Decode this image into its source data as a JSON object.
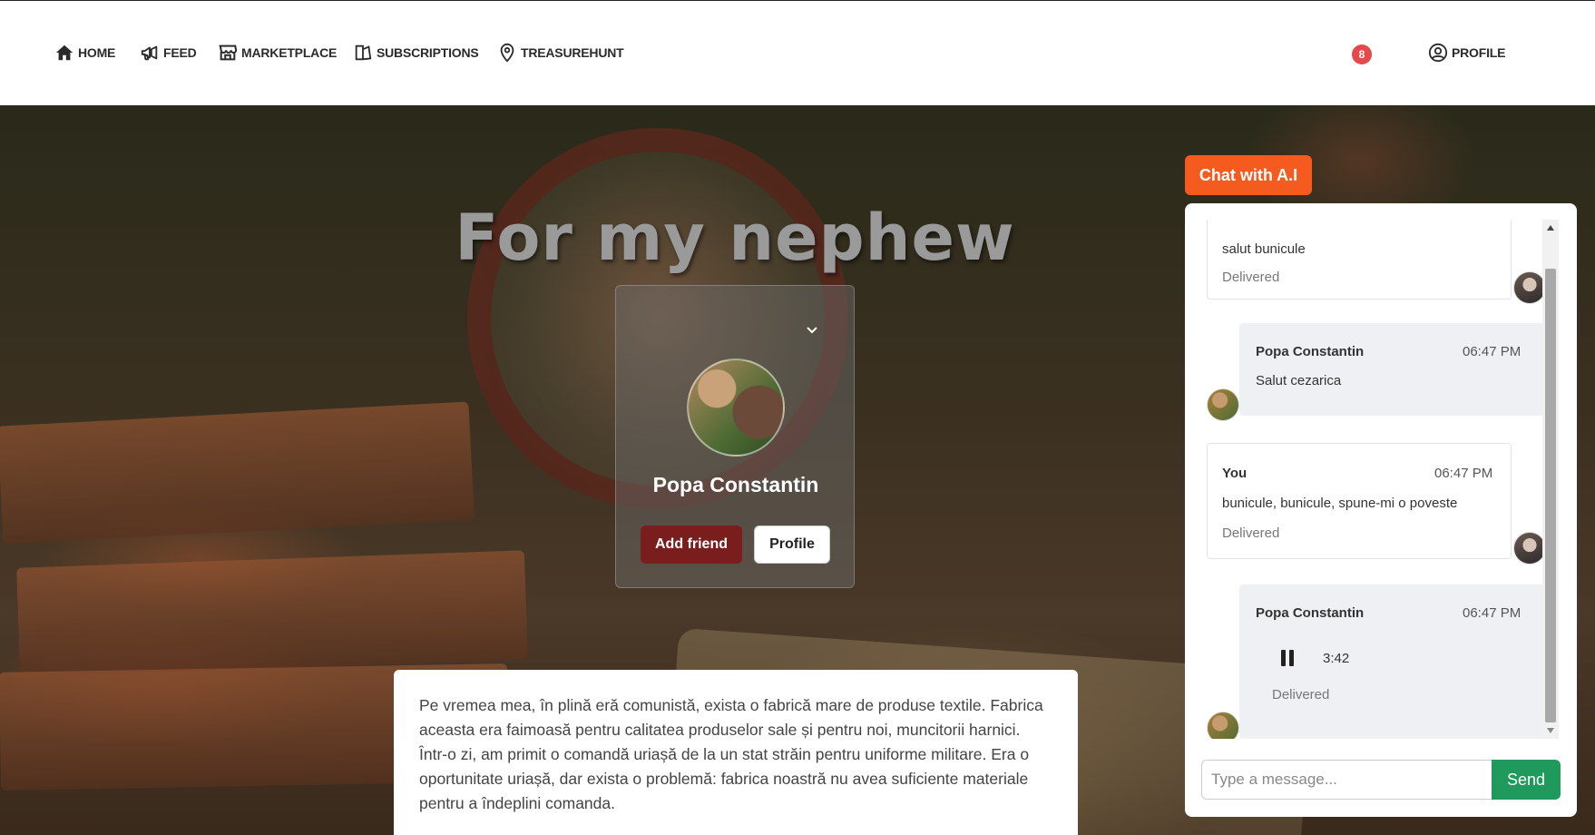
{
  "nav": {
    "home": "HOME",
    "feed": "FEED",
    "marketplace": "MARKETPLACE",
    "subscriptions": "SUBSCRIPTIONS",
    "treasurehunt": "TREASUREHUNT",
    "notifications_count": "8",
    "profile": "PROFILE"
  },
  "hero": {
    "title": "For my nephew"
  },
  "profile_card": {
    "name": "Popa Constantin",
    "add_friend_label": "Add friend",
    "profile_label": "Profile"
  },
  "story": {
    "text": "Pe vremea mea, în plină eră comunistă, exista o fabrică mare de produse textile. Fabrica aceasta era faimoasă pentru calitatea produselor sale și pentru noi, muncitorii harnici. Într-o zi, am primit o comandă uriașă de la un stat străin pentru uniforme militare. Era o oportunitate uriașă, dar exista o problemă: fabrica noastră nu avea suficiente materiale pentru a îndeplini comanda."
  },
  "chat": {
    "ai_button": "Chat with A.I",
    "messages": [
      {
        "text": "salut bunicule",
        "status": "Delivered"
      },
      {
        "name": "Popa Constantin",
        "time": "06:47 PM",
        "text": "Salut cezarica"
      },
      {
        "name": "You",
        "time": "06:47 PM",
        "text": "bunicule, bunicule, spune-mi o poveste",
        "status": "Delivered"
      },
      {
        "name": "Popa Constantin",
        "time": "06:47 PM",
        "audio_duration": "3:42",
        "status": "Delivered"
      }
    ],
    "input_placeholder": "Type a message...",
    "send_label": "Send"
  },
  "colors": {
    "ai_button": "#f55a1e",
    "add_friend": "#7a1d1d",
    "send": "#1f9a5c",
    "badge": "#e5484d"
  }
}
